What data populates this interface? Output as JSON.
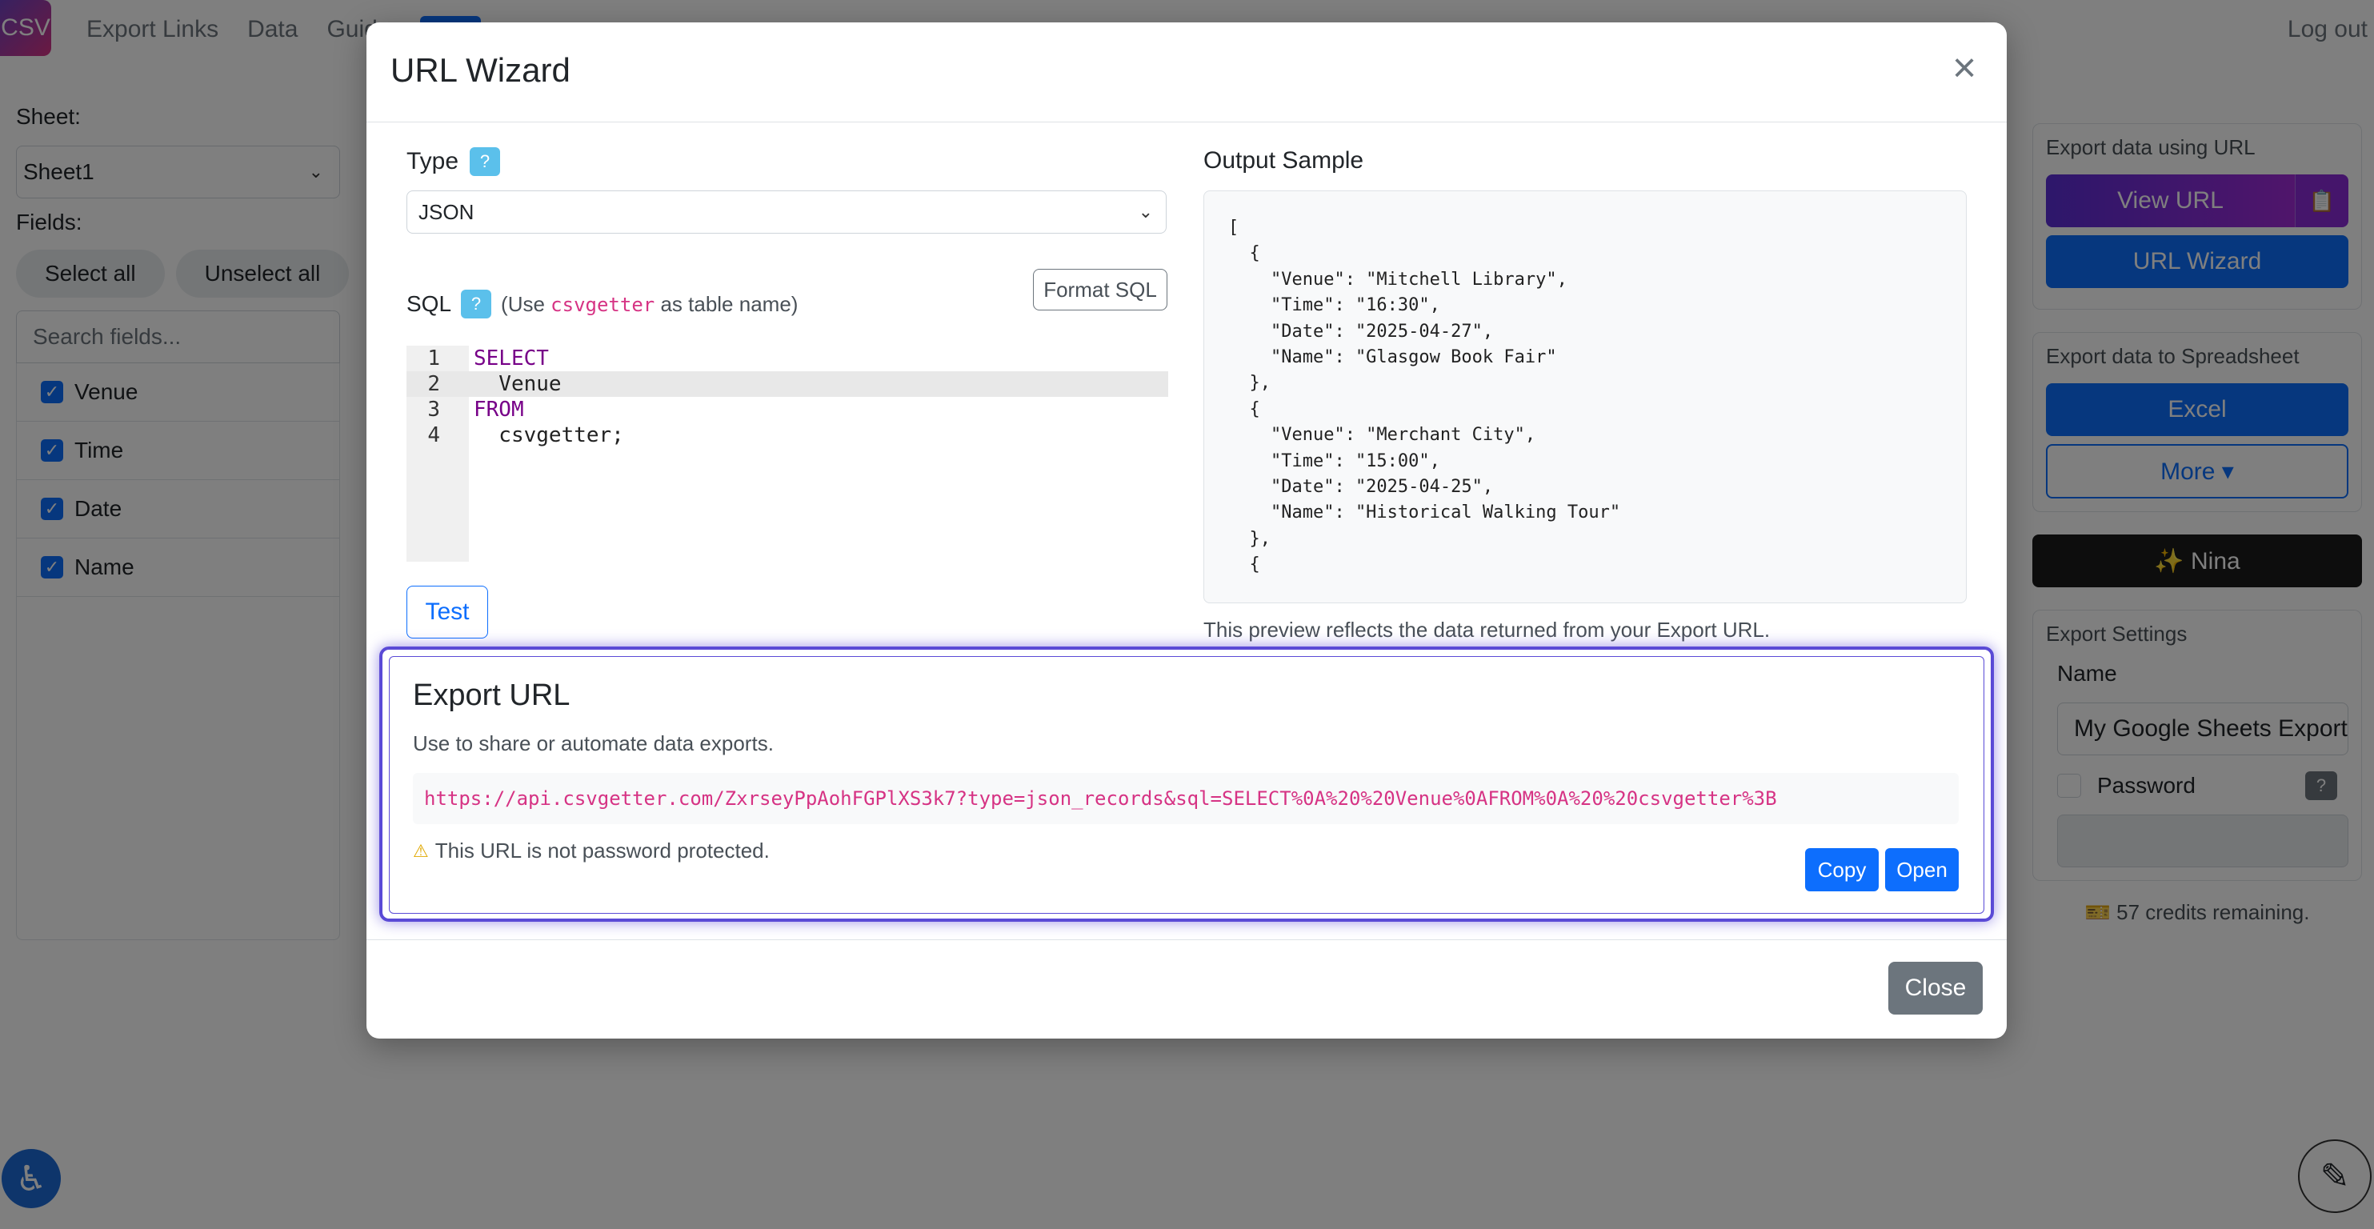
{
  "nav": {
    "brand": "CSV",
    "links": [
      "Export Links",
      "Data",
      "Guide"
    ],
    "logout": "Log out"
  },
  "left": {
    "sheet_label": "Sheet:",
    "sheet_value": "Sheet1",
    "fields_label": "Fields:",
    "select_all": "Select all",
    "unselect_all": "Unselect all",
    "search_placeholder": "Search fields...",
    "fields": [
      {
        "label": "Venue",
        "checked": true
      },
      {
        "label": "Time",
        "checked": true
      },
      {
        "label": "Date",
        "checked": true
      },
      {
        "label": "Name",
        "checked": true
      }
    ]
  },
  "right": {
    "export_url_title": "Export data using URL",
    "view_url": "View URL",
    "clipboard_icon": "clipboard-icon",
    "url_wizard": "URL Wizard",
    "export_sheet_title": "Export data to Spreadsheet",
    "excel": "Excel",
    "more": "More ▾",
    "nina": "✨ Nina",
    "settings_title": "Export Settings",
    "name_label": "Name",
    "name_value": "My Google Sheets Export",
    "password_label": "Password",
    "help_mark": "?",
    "credits": "57 credits remaining."
  },
  "modal": {
    "title": "URL Wizard",
    "type_label": "Type",
    "help_mark": "?",
    "type_value": "JSON",
    "sql_label": "SQL",
    "sql_hint_prefix": "(Use",
    "sql_hint_code": "csvgetter",
    "sql_hint_suffix": "as table name)",
    "format_sql": "Format SQL",
    "code_lines": [
      {
        "num": "1",
        "text": "SELECT",
        "keyword": true
      },
      {
        "num": "2",
        "text": "  Venue",
        "keyword": false
      },
      {
        "num": "3",
        "text": "FROM",
        "keyword": true
      },
      {
        "num": "4",
        "text": "  csvgetter;",
        "keyword": false
      }
    ],
    "active_line": 2,
    "test": "Test",
    "output_label": "Output Sample",
    "output_sample": "[\n  {\n    \"Venue\": \"Mitchell Library\",\n    \"Time\": \"16:30\",\n    \"Date\": \"2025-04-27\",\n    \"Name\": \"Glasgow Book Fair\"\n  },\n  {\n    \"Venue\": \"Merchant City\",\n    \"Time\": \"15:00\",\n    \"Date\": \"2025-04-25\",\n    \"Name\": \"Historical Walking Tour\"\n  },\n  {",
    "output_note": "This preview reflects the data returned from your Export URL.",
    "export_title": "Export URL",
    "export_sub": "Use to share or automate data exports.",
    "export_url": "https://api.csvgetter.com/ZxrseyPpAohFGPlXS3k7?type=json_records&sql=SELECT%0A%20%20Venue%0AFROM%0A%20%20csvgetter%3B",
    "warning": "This URL is not password protected.",
    "copy": "Copy",
    "open": "Open",
    "close": "Close"
  },
  "colors": {
    "primary": "#0d6efd",
    "accent_border": "#5a4ad6",
    "code_pink": "#d63384",
    "secondary": "#6c757d"
  }
}
